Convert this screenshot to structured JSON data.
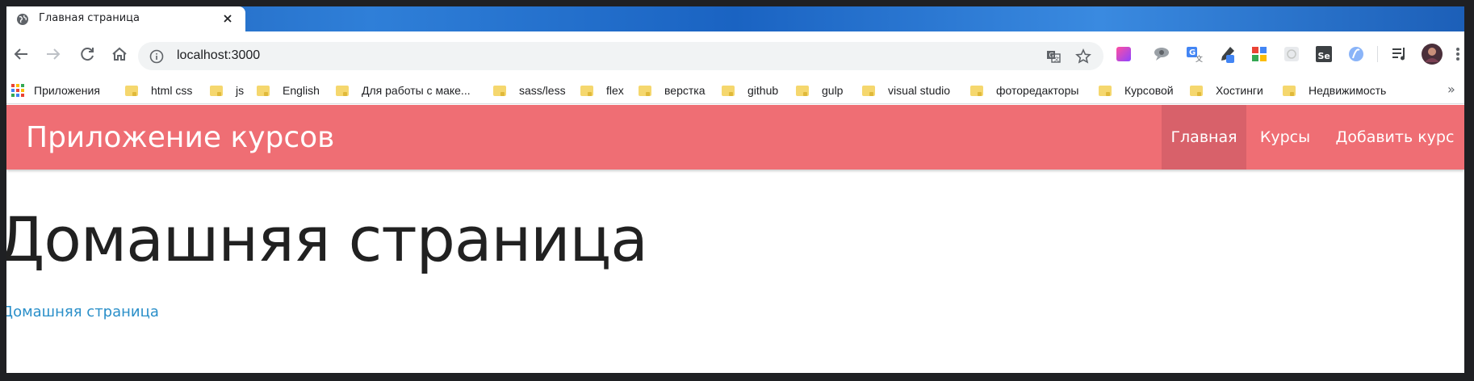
{
  "browser": {
    "tab": {
      "title": "Главная страница",
      "favicon": "globe-icon",
      "close": "close-icon"
    },
    "nav": {
      "back": "back-arrow-icon",
      "forward": "forward-arrow-icon",
      "reload": "reload-icon",
      "home": "home-icon"
    },
    "address_bar": {
      "url": "localhost:3000",
      "info": "info-icon",
      "translate": "translate-icon",
      "bookmark": "star-icon"
    },
    "extensions": [
      "color-gradient-icon",
      "chat-bubble-icon",
      "google-translate-icon",
      "eyedropper-icon",
      "grid-app-icon",
      "pattern-icon",
      "selenium-icon",
      "circle-logo-icon",
      "playlist-icon",
      "profile-avatar",
      "more-vert-icon"
    ],
    "bookmarks": {
      "apps_label": "Приложения",
      "items": [
        "html css",
        "js",
        "English",
        "Для работы с маке...",
        "sass/less",
        "flex",
        "верстка",
        "github",
        "gulp",
        "visual studio",
        "фоторедакторы",
        "Курсовой",
        "Хостинги",
        "Недвижимость"
      ],
      "more": "»"
    }
  },
  "site": {
    "brand": "Приложение курсов",
    "nav": [
      {
        "label": "Главная",
        "active": true
      },
      {
        "label": "Курсы",
        "active": false
      },
      {
        "label": "Добавить курс",
        "active": false
      }
    ],
    "heading": "Домашняя страница",
    "link_text": "Домашняя страница"
  },
  "colors": {
    "navbar_bg": "#ef6e74",
    "navbar_active": "#d8616a",
    "link": "#2a8fc9",
    "heading": "#212121"
  }
}
